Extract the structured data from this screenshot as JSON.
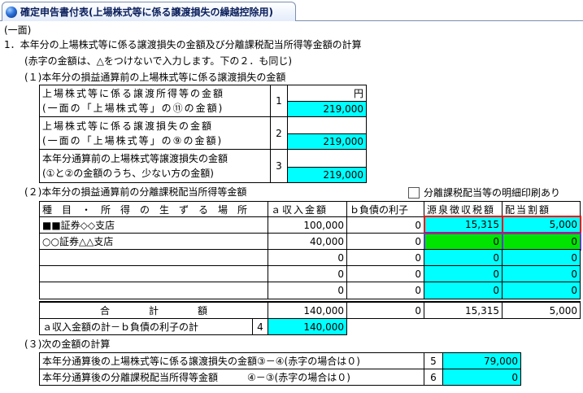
{
  "tab": {
    "title": "確定申告書付表(上場株式等に係る譲渡損失の繰越控除用)"
  },
  "page_label": "(一面)",
  "section1": {
    "heading": "1．本年分の上場株式等に係る譲渡損失の金額及び分離課税配当所得等金額の計算",
    "note": "(赤字の金額は、△をつけないで入力します。下の２．も同じ)"
  },
  "part1": {
    "heading": "(１)本年分の損益通算前の上場株式等に係る譲渡損失の金額",
    "unit": "円",
    "rows": [
      {
        "line1": "上場株式等に係る譲渡所得等の金額",
        "line2": "(一面の「上場株式等」の⑪の金額)",
        "no": "1",
        "value": "219,000"
      },
      {
        "line1": "上場株式等に係る譲渡損失の金額",
        "line2": "(一面の「上場株式等」の⑨の金額)",
        "no": "2",
        "value": "219,000"
      },
      {
        "line1": "本年分通算前の上場株式等譲渡損失の金額",
        "line2": "(①と②の金額のうち、少ない方の金額)",
        "no": "3",
        "value": "219,000"
      }
    ]
  },
  "part2": {
    "heading": "(２)本年分の損益通算前の分離課税配当所得等金額",
    "print_checkbox_label": "分離課税配当等の明細印刷あり",
    "headers": {
      "kind": "種　目　・　所　得　の　生　ず　る　場　所",
      "a": "ａ収入金額",
      "b": "ｂ負債の利子",
      "tax": "源泉徴収税額",
      "dividend": "配当割額"
    },
    "rows": [
      {
        "place": "■■証券◇◇支店",
        "a": "100,000",
        "b": "0",
        "tax": "15,315",
        "dividend": "5,000"
      },
      {
        "place": "○○証券△△支店",
        "a": "40,000",
        "b": "0",
        "tax": "0",
        "dividend": "0"
      },
      {
        "place": "",
        "a": "0",
        "b": "0",
        "tax": "0",
        "dividend": "0"
      },
      {
        "place": "",
        "a": "0",
        "b": "0",
        "tax": "0",
        "dividend": "0"
      },
      {
        "place": "",
        "a": "0",
        "b": "0",
        "tax": "0",
        "dividend": "0"
      }
    ],
    "total": {
      "label": "合　　　　計　　　　額",
      "a": "140,000",
      "b": "0",
      "tax": "15,315",
      "dividend": "5,000"
    },
    "net": {
      "label": "ａ収入金額の計－ｂ負債の利子の計",
      "no": "4",
      "value": "140,000"
    }
  },
  "part3": {
    "heading": "(３)次の金額の計算",
    "rows": [
      {
        "label": "本年分通算後の上場株式等に係る譲渡損失の金額③－④(赤字の場合は０)",
        "no": "5",
        "value": "79,000"
      },
      {
        "label": "本年分通算後の分離課税配当所得等金額　　　④－③(赤字の場合は０)",
        "no": "6",
        "value": "0"
      }
    ]
  }
}
